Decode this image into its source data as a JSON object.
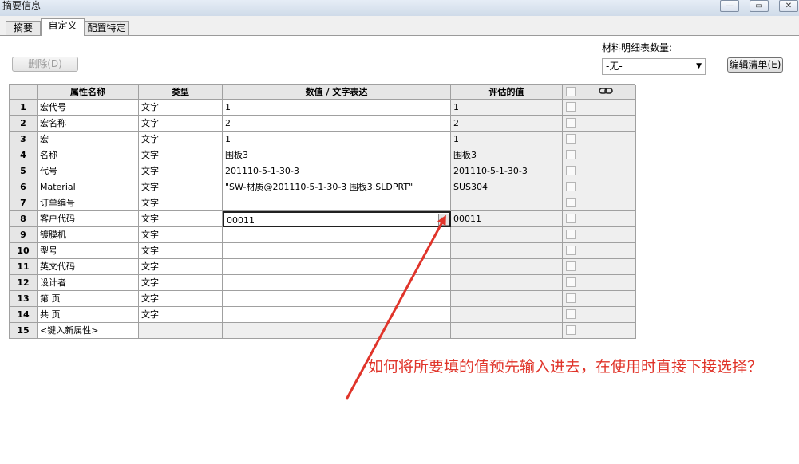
{
  "window": {
    "title": "摘要信息",
    "buttons": [
      "—",
      "▭",
      "✕"
    ]
  },
  "tabs": [
    {
      "label": "摘要",
      "active": false
    },
    {
      "label": "自定义",
      "active": true
    },
    {
      "label": "配置特定",
      "active": false
    }
  ],
  "toolbar": {
    "delete_label": "删除(D)",
    "bom_label": "材料明细表数量:",
    "bom_value": "-无-",
    "edit_list_label": "编辑清单(E)"
  },
  "table": {
    "headers": [
      "属性名称",
      "类型",
      "数值 / 文字表达",
      "评估的值"
    ],
    "rows": [
      {
        "num": "1",
        "name": "宏代号",
        "type": "文字",
        "value": "1",
        "evaluated": "1"
      },
      {
        "num": "2",
        "name": "宏名称",
        "type": "文字",
        "value": "2",
        "evaluated": "2"
      },
      {
        "num": "3",
        "name": "宏",
        "type": "文字",
        "value": "1",
        "evaluated": "1"
      },
      {
        "num": "4",
        "name": "名称",
        "type": "文字",
        "value": "围板3",
        "evaluated": "围板3"
      },
      {
        "num": "5",
        "name": "代号",
        "type": "文字",
        "value": "201110-5-1-30-3",
        "evaluated": "201110-5-1-30-3"
      },
      {
        "num": "6",
        "name": "Material",
        "type": "文字",
        "value": "\"SW-材质@201110-5-1-30-3 围板3.SLDPRT\"",
        "evaluated": "SUS304"
      },
      {
        "num": "7",
        "name": "订单编号",
        "type": "文字",
        "value": "",
        "evaluated": ""
      },
      {
        "num": "8",
        "name": "客户代码",
        "type": "文字",
        "value": "00011",
        "evaluated": "00011"
      },
      {
        "num": "9",
        "name": "镀膜机",
        "type": "文字",
        "value": "",
        "evaluated": ""
      },
      {
        "num": "10",
        "name": "型号",
        "type": "文字",
        "value": "",
        "evaluated": ""
      },
      {
        "num": "11",
        "name": "英文代码",
        "type": "文字",
        "value": "",
        "evaluated": ""
      },
      {
        "num": "12",
        "name": "设计者",
        "type": "文字",
        "value": "",
        "evaluated": ""
      },
      {
        "num": "13",
        "name": "第 页",
        "type": "文字",
        "value": "",
        "evaluated": ""
      },
      {
        "num": "14",
        "name": "共 页",
        "type": "文字",
        "value": "",
        "evaluated": ""
      },
      {
        "num": "15",
        "name": "<键入新属性>",
        "type": "",
        "value": "",
        "evaluated": ""
      }
    ]
  },
  "annotation": {
    "text": "如何将所要填的值预先输入进去，在使用时直接下接选择？",
    "color": "#e0342a"
  }
}
